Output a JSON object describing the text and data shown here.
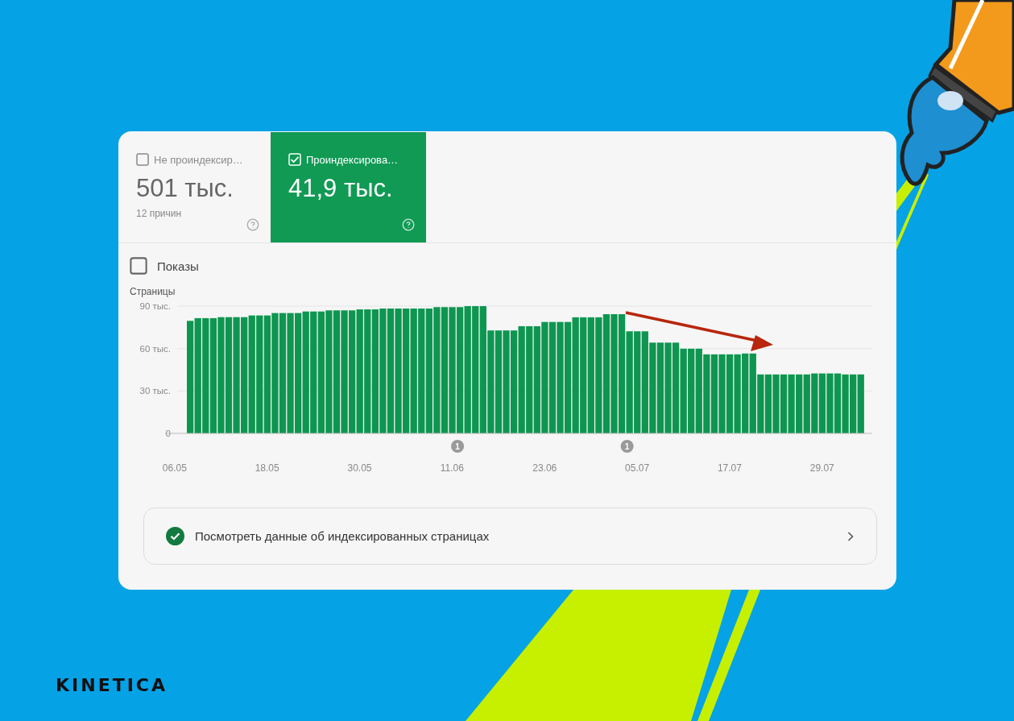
{
  "brand": {
    "logo": "KINETICA"
  },
  "tabs": [
    {
      "label": "Не проиндексир…",
      "value": "501 тыс.",
      "note": "12 причин",
      "checked": false,
      "selected": false
    },
    {
      "label": "Проиндексирова…",
      "value": "41,9 тыс.",
      "checked": true,
      "selected": true
    }
  ],
  "impressions": {
    "label": "Показы",
    "checked": false
  },
  "chart": {
    "chart_data": {
      "type": "bar",
      "ylabel": "Страницы",
      "categories": [
        "06.05",
        null,
        null,
        null,
        null,
        null,
        null,
        null,
        null,
        null,
        null,
        null,
        "18.05",
        null,
        null,
        null,
        null,
        null,
        null,
        null,
        null,
        null,
        null,
        null,
        "30.05",
        null,
        null,
        null,
        null,
        null,
        null,
        null,
        null,
        null,
        null,
        null,
        "11.06",
        null,
        null,
        null,
        null,
        null,
        null,
        null,
        null,
        null,
        null,
        null,
        "23.06",
        null,
        null,
        null,
        null,
        null,
        null,
        null,
        null,
        null,
        null,
        null,
        "05.07",
        null,
        null,
        null,
        null,
        null,
        null,
        null,
        null,
        null,
        null,
        null,
        "17.07",
        null,
        null,
        null,
        null,
        null,
        null,
        null,
        null,
        null,
        null,
        null,
        "29.07",
        null,
        null,
        null,
        null,
        null
      ],
      "values": [
        null,
        null,
        79.6,
        81.5,
        81.5,
        81.5,
        82.2,
        82.2,
        82.2,
        82.2,
        83.4,
        83.4,
        83.4,
        85.1,
        85.1,
        85.1,
        85.1,
        86.2,
        86.2,
        86.2,
        87,
        87,
        87,
        87,
        87.7,
        87.7,
        87.7,
        88.3,
        88.3,
        88.3,
        88.3,
        88.3,
        88.3,
        88.3,
        89.3,
        89.3,
        89.3,
        89.3,
        90,
        90,
        90,
        72.8,
        72.8,
        72.8,
        72.8,
        75.8,
        75.8,
        75.8,
        78.8,
        78.8,
        78.8,
        78.8,
        82.1,
        82.1,
        82.1,
        82.1,
        84.3,
        84.3,
        84.3,
        72.2,
        72.2,
        72.2,
        64.2,
        64.2,
        64.2,
        64.2,
        59.9,
        59.9,
        59.9,
        55.9,
        55.9,
        55.9,
        55.9,
        55.9,
        56.5,
        56.5,
        41.7,
        41.7,
        41.7,
        41.7,
        41.7,
        41.7,
        41.7,
        42.4,
        42.4,
        42.4,
        42.4,
        41.7,
        41.7,
        41.7
      ],
      "ylim": [
        0,
        90
      ],
      "yticks": [
        {
          "value": 0,
          "label": "0"
        },
        {
          "value": 30,
          "label": "30 тыс."
        },
        {
          "value": 60,
          "label": "60 тыс."
        },
        {
          "value": 90,
          "label": "90 тыс."
        }
      ],
      "annotations": [
        {
          "text": "1"
        },
        {
          "text": "1"
        }
      ]
    }
  },
  "details_link": {
    "label": "Посмотреть данные об индексированных страницах"
  }
}
